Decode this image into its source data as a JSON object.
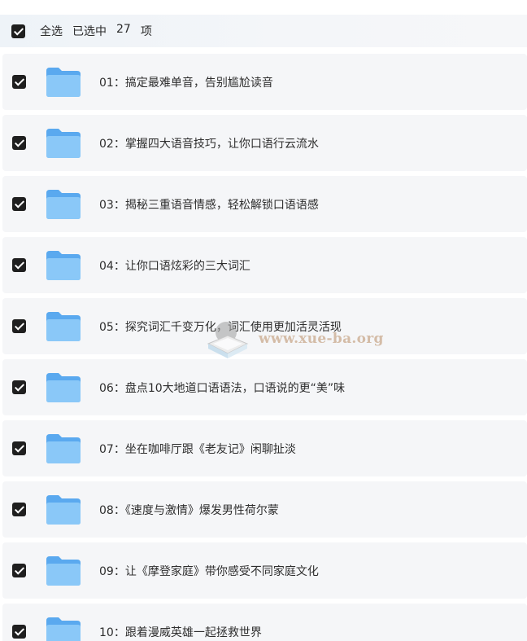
{
  "header": {
    "select_all": "全选",
    "selected_prefix": "已选中",
    "selected_count": "27",
    "selected_suffix": "项"
  },
  "items": [
    {
      "label": "01：搞定最难单音，告别尴尬读音"
    },
    {
      "label": "02：掌握四大语音技巧，让你口语行云流水"
    },
    {
      "label": "03：揭秘三重语音情感，轻松解锁口语语感"
    },
    {
      "label": "04：让你口语炫彩的三大词汇"
    },
    {
      "label": "05：探究词汇千变万化，词汇使用更加活灵活现"
    },
    {
      "label": "06：盘点10大地道口语语法，口语说的更“美”味"
    },
    {
      "label": "07：坐在咖啡厅跟《老友记》闲聊扯淡"
    },
    {
      "label": "08：《速度与激情》爆发男性荷尔蒙"
    },
    {
      "label": "09：让《摩登家庭》带你感受不同家庭文化"
    },
    {
      "label": "10：跟着漫威英雄一起拯救世界"
    }
  ],
  "watermark": {
    "text": "www.xue-ba.org"
  },
  "icons": {
    "checkbox": "checkbox-checked-icon",
    "folder": "folder-icon"
  },
  "colors": {
    "folder_back": "#5aa9ef",
    "folder_front": "#8ac8f8",
    "checkbox": "#1f1f1f",
    "row_background": "#f5f6f8"
  }
}
